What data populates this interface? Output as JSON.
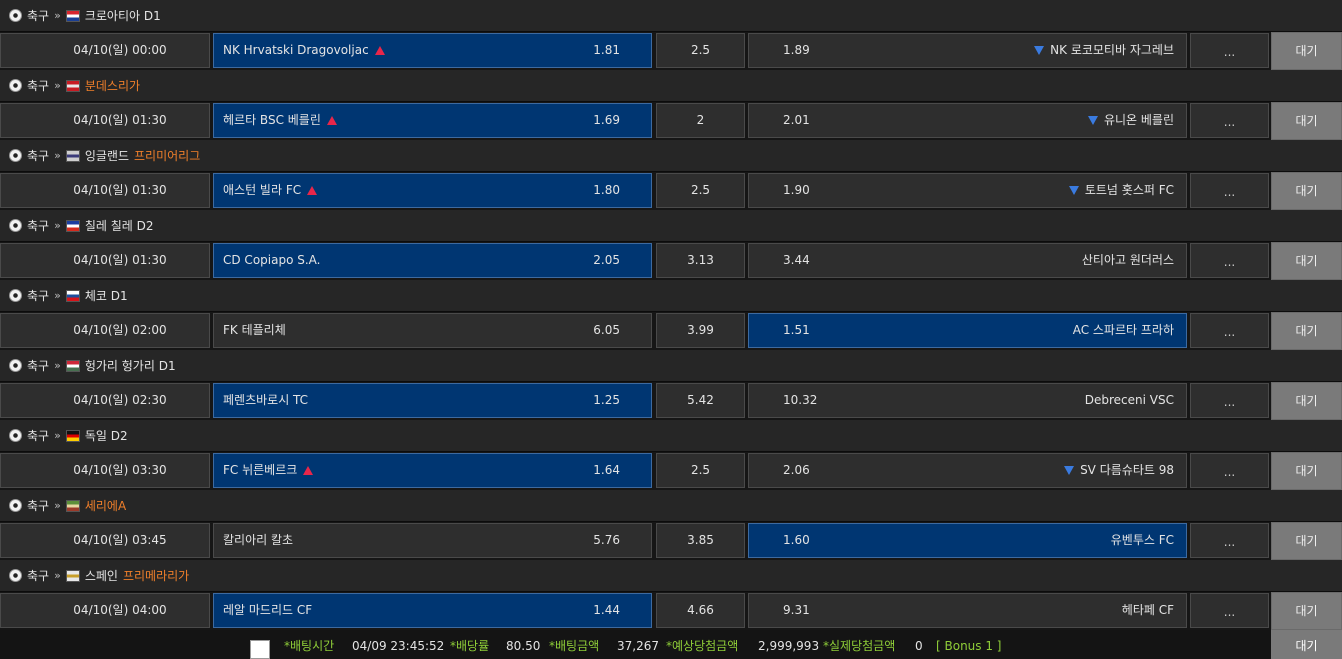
{
  "sections": [
    {
      "sport": "축구",
      "separator": "»",
      "league": "크로아티아 D1",
      "league_highlight": false,
      "flag_colors": [
        "#d8262f",
        "#ffffff",
        "#1a3f94"
      ],
      "match": {
        "datetime": "04/10(일) 00:00",
        "home": "NK Hrvatski Dragovoljac",
        "home_odd": "1.81",
        "home_trend": "up",
        "draw": "2.5",
        "away_odd": "1.89",
        "away": "NK 로코모티바 자그레브",
        "away_trend": "down",
        "more": "...",
        "status": "대기",
        "selected": "home"
      }
    },
    {
      "sport": "축구",
      "separator": "»",
      "league": "분데스리가",
      "league_highlight": true,
      "flag_colors": [
        "#c81c24",
        "#e8e8e8",
        "#c81c24"
      ],
      "match": {
        "datetime": "04/10(일) 01:30",
        "home": "헤르타 BSC 베를린",
        "home_odd": "1.69",
        "home_trend": "up",
        "draw": "2",
        "away_odd": "2.01",
        "away": "유니온 베를린",
        "away_trend": "down",
        "more": "...",
        "status": "대기",
        "selected": "home"
      }
    },
    {
      "sport": "축구",
      "separator": "»",
      "league": "잉글랜드 프리미어리그",
      "league_prefix": "잉글랜드 ",
      "league_name": "프리미어리그",
      "league_highlight": true,
      "flag_colors": [
        "#cfcfcf",
        "#3b3b7a",
        "#cfcfcf"
      ],
      "match": {
        "datetime": "04/10(일) 01:30",
        "home": "애스턴 빌라 FC",
        "home_odd": "1.80",
        "home_trend": "up",
        "draw": "2.5",
        "away_odd": "1.90",
        "away": "토트넘 홋스퍼 FC",
        "away_trend": "down",
        "more": "...",
        "status": "대기",
        "selected": "home"
      }
    },
    {
      "sport": "축구",
      "separator": "»",
      "league": "칠레 칠레 D2",
      "league_highlight": false,
      "flag_colors": [
        "#1c3ea0",
        "#ffffff",
        "#d52b1e"
      ],
      "match": {
        "datetime": "04/10(일) 01:30",
        "home": "CD Copiapo S.A.",
        "home_odd": "2.05",
        "home_trend": "",
        "draw": "3.13",
        "away_odd": "3.44",
        "away": "산티아고 원더러스",
        "away_trend": "",
        "more": "...",
        "status": "대기",
        "selected": "home"
      }
    },
    {
      "sport": "축구",
      "separator": "»",
      "league": "체코 D1",
      "league_highlight": false,
      "flag_colors": [
        "#ffffff",
        "#1d4f9e",
        "#d7141a"
      ],
      "match": {
        "datetime": "04/10(일) 02:00",
        "home": "FK 테플리체",
        "home_odd": "6.05",
        "home_trend": "",
        "draw": "3.99",
        "away_odd": "1.51",
        "away": "AC 스파르타 프라하",
        "away_trend": "",
        "more": "...",
        "status": "대기",
        "selected": "away"
      }
    },
    {
      "sport": "축구",
      "separator": "»",
      "league": "헝가리 헝가리 D1",
      "league_highlight": false,
      "flag_colors": [
        "#ce2939",
        "#ffffff",
        "#477050"
      ],
      "match": {
        "datetime": "04/10(일) 02:30",
        "home": "페렌츠바로시 TC",
        "home_odd": "1.25",
        "home_trend": "",
        "draw": "5.42",
        "away_odd": "10.32",
        "away": "Debreceni VSC",
        "away_trend": "",
        "more": "...",
        "status": "대기",
        "selected": "home"
      }
    },
    {
      "sport": "축구",
      "separator": "»",
      "league": "독일 D2",
      "league_highlight": false,
      "flag_colors": [
        "#111111",
        "#dd0000",
        "#ffce00"
      ],
      "match": {
        "datetime": "04/10(일) 03:30",
        "home": "FC 뉘른베르크",
        "home_odd": "1.64",
        "home_trend": "up",
        "draw": "2.5",
        "away_odd": "2.06",
        "away": "SV 다름슈타트 98",
        "away_trend": "down",
        "more": "...",
        "status": "대기",
        "selected": "home"
      }
    },
    {
      "sport": "축구",
      "separator": "»",
      "league": "세리에A",
      "league_highlight": true,
      "flag_colors": [
        "#5d8f3a",
        "#e7d7a2",
        "#9b3a2a"
      ],
      "match": {
        "datetime": "04/10(일) 03:45",
        "home": "칼리아리 칼초",
        "home_odd": "5.76",
        "home_trend": "",
        "draw": "3.85",
        "away_odd": "1.60",
        "away": "유벤투스 FC",
        "away_trend": "",
        "more": "...",
        "status": "대기",
        "selected": "away"
      }
    },
    {
      "sport": "축구",
      "separator": "»",
      "league": "스페인 프리메라리가",
      "league_prefix": "스페인 ",
      "league_name": "프리메라리가",
      "league_highlight": true,
      "flag_colors": [
        "#e8e8e8",
        "#c89f2a",
        "#e8e8e8"
      ],
      "match": {
        "datetime": "04/10(일) 04:00",
        "home": "레알 마드리드 CF",
        "home_odd": "1.44",
        "home_trend": "",
        "draw": "4.66",
        "away_odd": "9.31",
        "away": "헤타페 CF",
        "away_trend": "",
        "more": "...",
        "status": "대기",
        "selected": "home"
      }
    }
  ],
  "footer": {
    "bet_time_label": "*배팅시간",
    "bet_time": "04/09 23:45:52",
    "odds_label": "*배당률",
    "odds": "80.50",
    "amount_label": "*배팅금액",
    "amount": "37,267",
    "expected_label": "*예상당첨금액",
    "expected": "2,999,993",
    "actual_label": "*실제당첨금액",
    "actual": "0",
    "bonus": "[ Bonus 1 ]",
    "bet_button": "대기"
  },
  "colors": {
    "selected_bg": "#003672",
    "highlight_league": "#f07f2a",
    "up_arrow": "#e8264a",
    "down_arrow": "#3a7be0",
    "footer_label": "#8fce38"
  }
}
